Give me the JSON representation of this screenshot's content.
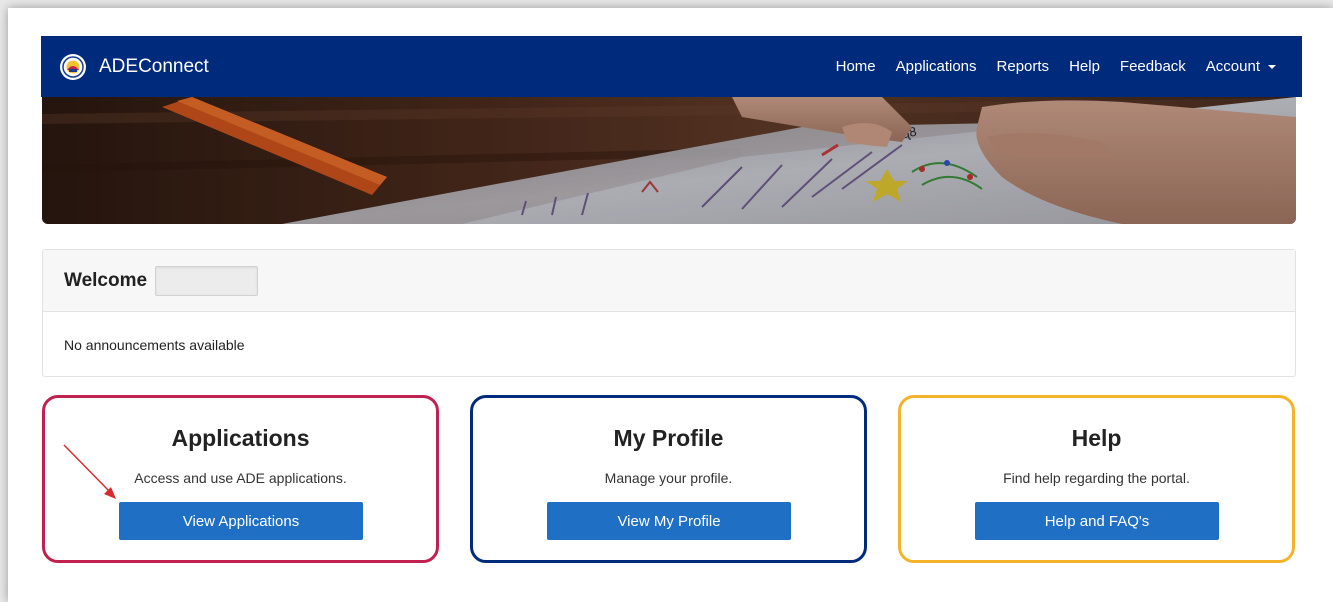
{
  "colors": {
    "navbar": "#002a7c",
    "button": "#1f6fc5",
    "applications_border": "#c0214f",
    "profile_border": "#002a7c",
    "help_border": "#f5b32c",
    "arrow": "#d62c2c"
  },
  "navbar": {
    "brand": "ADEConnect",
    "links": [
      "Home",
      "Applications",
      "Reports",
      "Help",
      "Feedback"
    ],
    "account_label": "Account"
  },
  "welcome": {
    "title": "Welcome",
    "announcement": "No announcements available"
  },
  "cards": [
    {
      "title": "Applications",
      "description": "Access and use ADE applications.",
      "button": "View Applications"
    },
    {
      "title": "My Profile",
      "description": "Manage your profile.",
      "button": "View My Profile"
    },
    {
      "title": "Help",
      "description": "Find help regarding the portal.",
      "button": "Help and FAQ's"
    }
  ]
}
